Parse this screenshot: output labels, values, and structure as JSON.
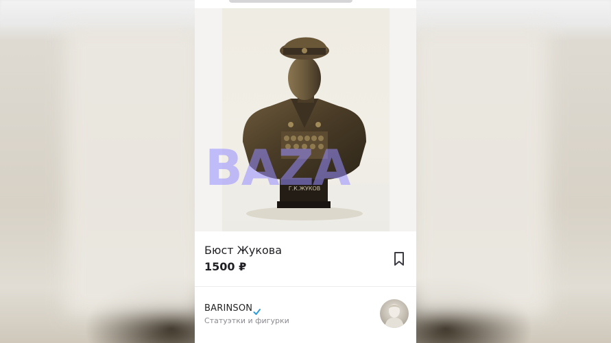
{
  "listing": {
    "title": "Бюст Жукова",
    "price": "1500 ₽",
    "bust_plaque": "Г.К.ЖУКОВ",
    "watermark": "BAZA"
  },
  "seller": {
    "name": "BARINSON",
    "category": "Статуэтки и фигурки",
    "verified": true
  },
  "icons": {
    "bookmark": "bookmark-icon",
    "verified": "verified-check-icon"
  },
  "colors": {
    "watermark": "#968cff",
    "verified": "#2e9bd6",
    "text": "#1f1f24",
    "muted": "#8a8a90"
  }
}
